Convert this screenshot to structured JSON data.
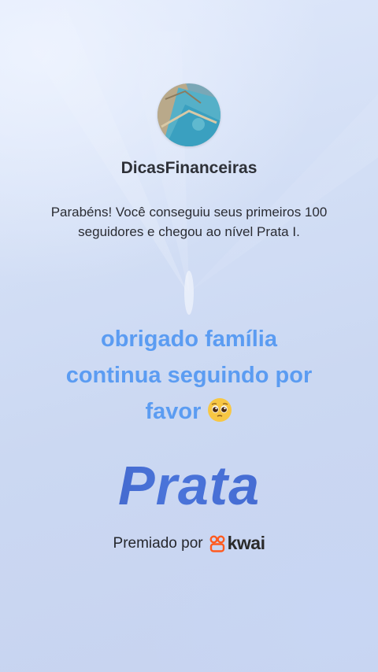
{
  "profile": {
    "username": "DicasFinanceiras",
    "avatar_icon": "money-bills-avatar"
  },
  "message": "Parabéns! Você conseguiu seus primeiros 100 seguidores e chegou ao nível Prata I.",
  "thanks": {
    "line1": "obrigado família",
    "line2": "continua seguindo por",
    "line3": "favor",
    "emoji_icon": "pleading-face-emoji"
  },
  "tier_label": "Prata",
  "award": {
    "text": "Premiado por",
    "brand": "kwai",
    "brand_icon": "kwai-logo-icon"
  },
  "colors": {
    "thanks_text": "#5b9cf2",
    "tier_gradient_start": "#3a56b8",
    "tier_gradient_end": "#4a74da",
    "kwai_brand": "#ff5a1f"
  }
}
